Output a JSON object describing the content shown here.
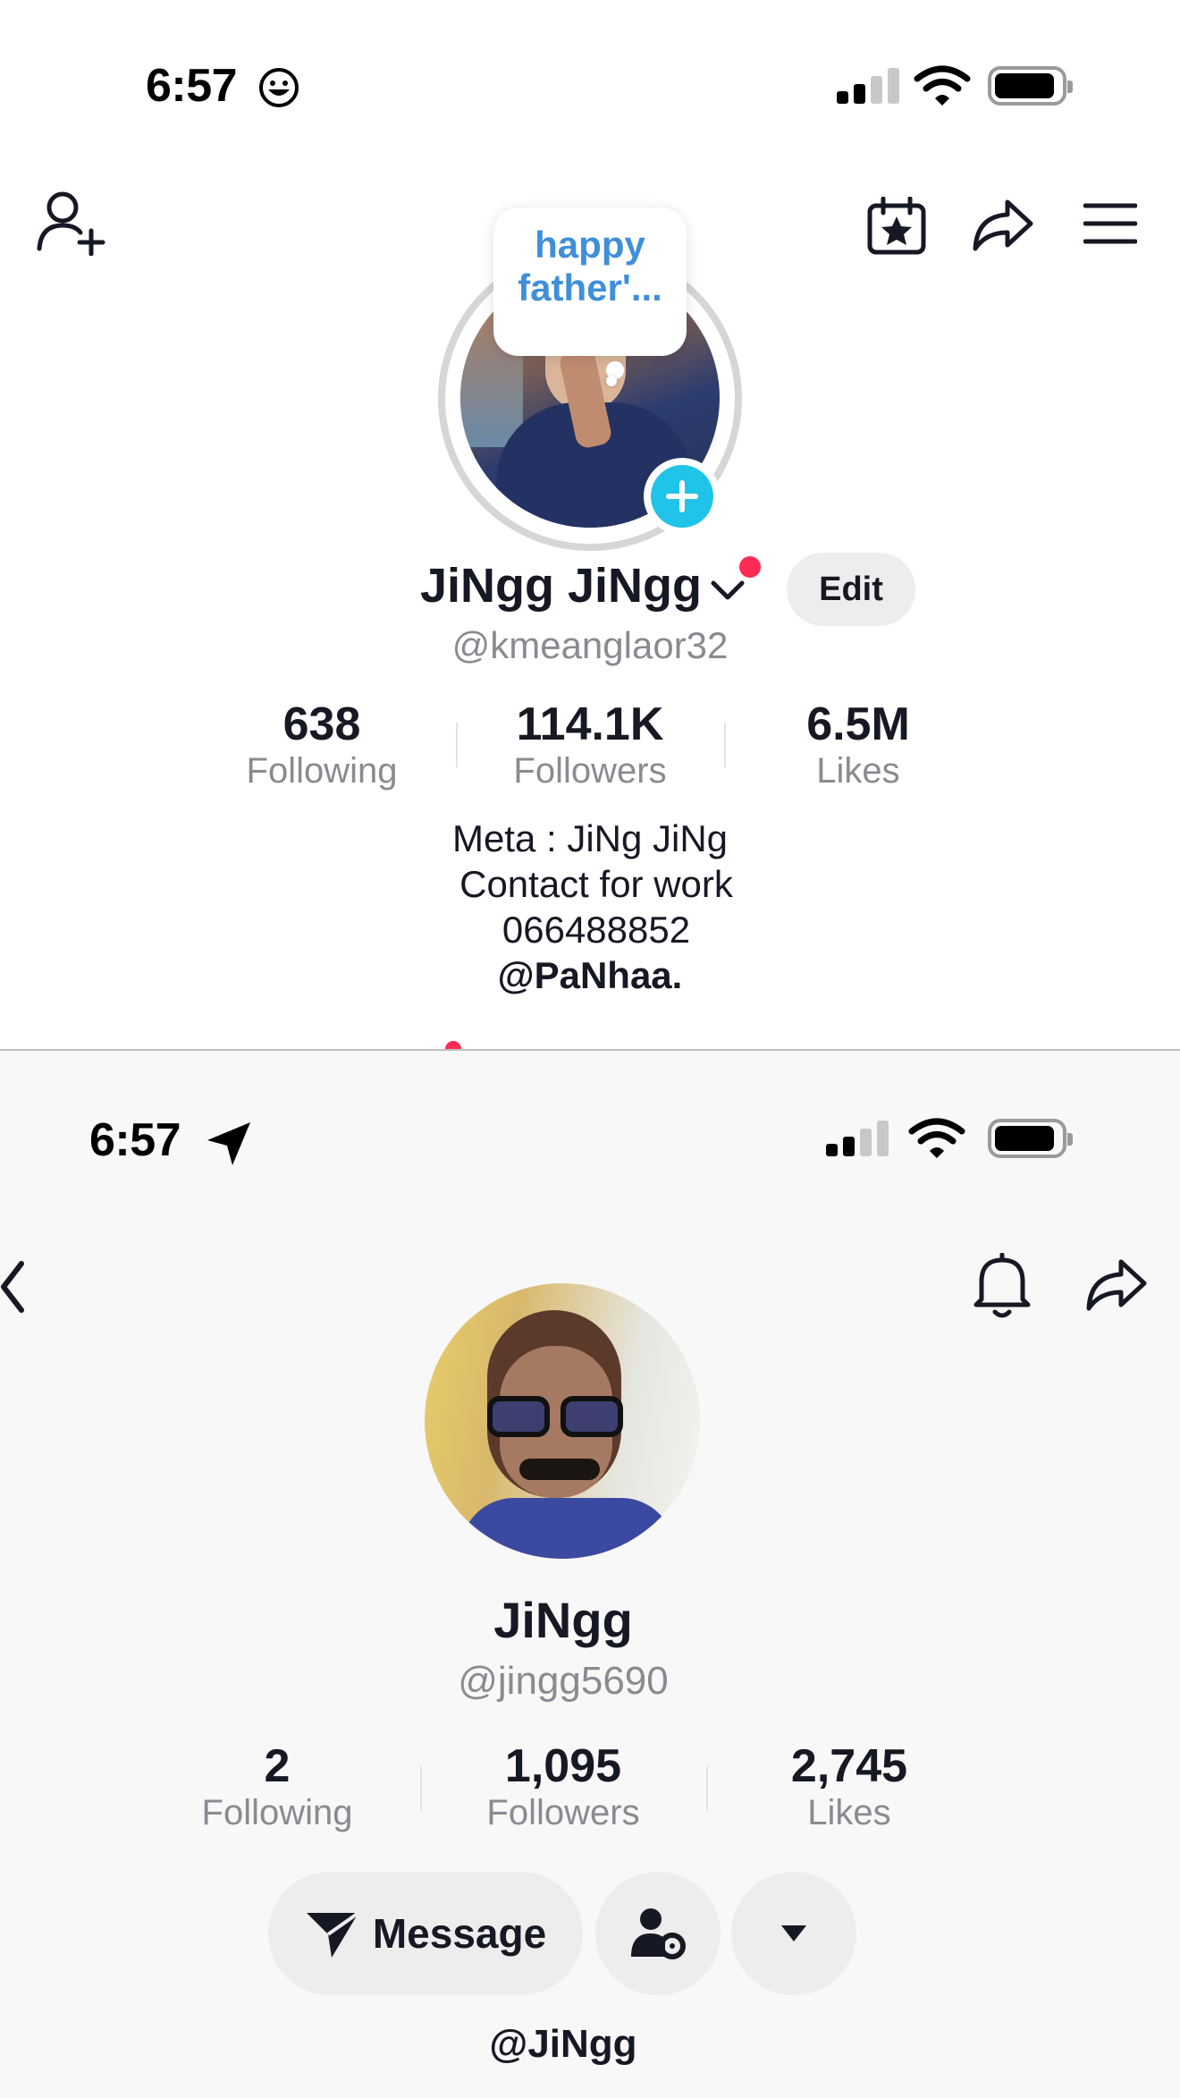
{
  "top_screen": {
    "status_time": "6:57",
    "note_bubble": "happy father'...",
    "display_name": "JiNgg JiNgg",
    "edit_label": "Edit",
    "username": "@kmeanglaor32",
    "stats": [
      {
        "value": "638",
        "label": "Following"
      },
      {
        "value": "114.1K",
        "label": "Followers"
      },
      {
        "value": "6.5M",
        "label": "Likes"
      }
    ],
    "bio": {
      "line1": "Meta : JiNg JiNg",
      "line2": "Contact for work",
      "line3": "066488852",
      "mention": "@PaNhaa."
    },
    "colors": {
      "accent_cyan": "#20c4e8",
      "notif_red": "#fe2c55",
      "note_blue": "#3f8fd9"
    }
  },
  "bottom_screen": {
    "status_time": "6:57",
    "display_name": "JiNgg",
    "username": "@jingg5690",
    "stats": [
      {
        "value": "2",
        "label": "Following"
      },
      {
        "value": "1,095",
        "label": "Followers"
      },
      {
        "value": "2,745",
        "label": "Likes"
      }
    ],
    "message_label": "Message",
    "bio_mention": "@JiNgg"
  }
}
